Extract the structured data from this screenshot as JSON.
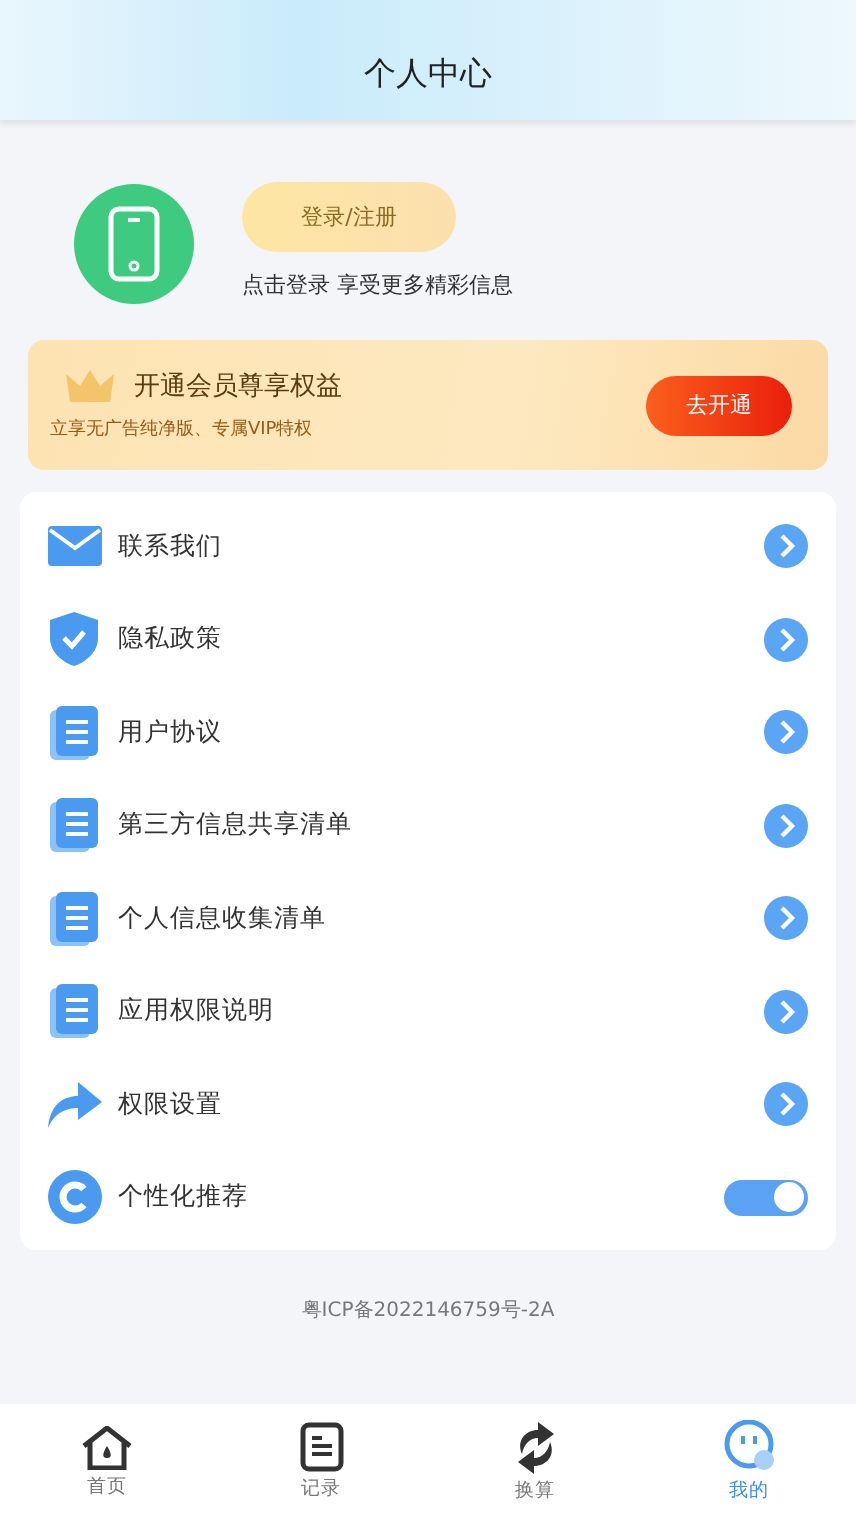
{
  "header": {
    "title": "个人中心"
  },
  "profile": {
    "login_button": "登录/注册",
    "hint": "点击登录 享受更多精彩信息"
  },
  "vip": {
    "title": "开通会员尊享权益",
    "subtitle": "立享无广告纯净版、专属VIP特权",
    "button": "去开通"
  },
  "menu": [
    {
      "kind": "link",
      "label": "联系我们"
    },
    {
      "kind": "link",
      "label": "隐私政策"
    },
    {
      "kind": "link",
      "label": "用户协议"
    },
    {
      "kind": "link",
      "label": "第三方信息共享清单"
    },
    {
      "kind": "link",
      "label": "个人信息收集清单"
    },
    {
      "kind": "link",
      "label": "应用权限说明"
    },
    {
      "kind": "link",
      "label": "权限设置"
    },
    {
      "kind": "toggle",
      "label": "个性化推荐",
      "on": true
    }
  ],
  "footer": "粤ICP备2022146759号-2A",
  "tabs": [
    {
      "label": "首页",
      "selected": false
    },
    {
      "label": "记录",
      "selected": false
    },
    {
      "label": "换算",
      "selected": false
    },
    {
      "label": "我的",
      "selected": true
    }
  ]
}
